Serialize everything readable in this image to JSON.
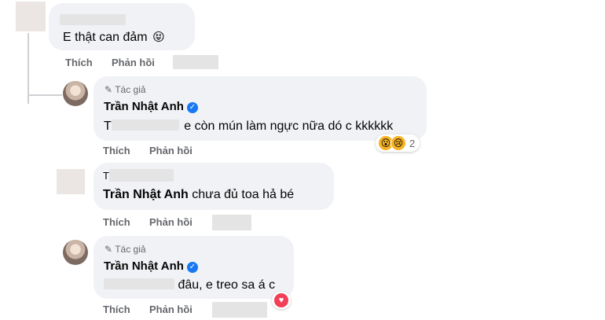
{
  "comments": [
    {
      "text": "E thật can đảm",
      "emoji_icon": "squinting-tongue-emoji",
      "emoji_glyph": "😝",
      "actions": {
        "like": "Thích",
        "reply": "Phản hồi"
      }
    },
    {
      "badge": "Tác giả",
      "author": "Trần Nhật Anh",
      "text_prefix": "T",
      "text": "e còn mún làm ngực nữa dó c kkkkkk",
      "reactions": {
        "icons": [
          "wow-icon",
          "sad-icon"
        ],
        "count": "2"
      },
      "actions": {
        "like": "Thích",
        "reply": "Phản hồi"
      }
    },
    {
      "text_prefix": "T",
      "mention": "Trần Nhật Anh",
      "text": "chưa đủ toa hả bé",
      "actions": {
        "like": "Thích",
        "reply": "Phản hồi"
      }
    },
    {
      "badge": "Tác giả",
      "author": "Trần Nhật Anh",
      "text": "đâu, e treo sa á c",
      "reactions": {
        "icons": [
          "heart-icon"
        ]
      },
      "actions": {
        "like": "Thích",
        "reply": "Phản hồi"
      }
    }
  ],
  "colors": {
    "bubble": "#f0f2f5",
    "secondary_text": "#65676b",
    "verified": "#1877f2",
    "heart": "#f33e58"
  }
}
